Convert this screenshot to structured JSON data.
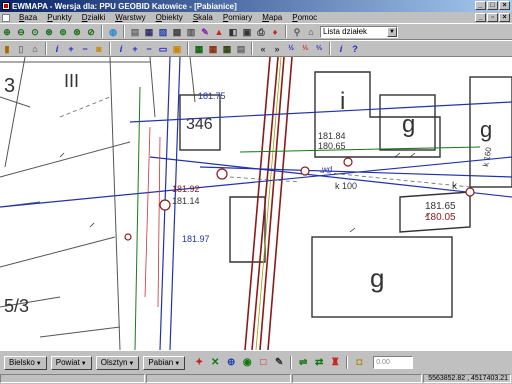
{
  "window": {
    "title": "EWMAPA - Wersja dla: PPU GEOBID Katowice - [Pabianice]"
  },
  "menu": {
    "items": [
      "Baza",
      "Punkty",
      "Działki",
      "Warstwy",
      "Obiekty",
      "Skala",
      "Pomiary",
      "Mapa",
      "Pomoc"
    ]
  },
  "toolbar": {
    "parcel_combo": "Lista działek"
  },
  "bottom": {
    "nav": [
      "Bielsko",
      "Powiat",
      "Olsztyn",
      "Pabian"
    ],
    "scale_value": "0.00"
  },
  "status": {
    "coordinates": "5563852.82 , 4517403.21"
  },
  "map": {
    "labels": {
      "lbl_3_left": "3",
      "lbl_iii": "III",
      "lbl_346": "346",
      "lbl_i": "i",
      "lbl_g1": "g",
      "lbl_g2": "g",
      "lbl_g3": "g",
      "lbl_53": "5/3",
      "lbl_18175": "181.75",
      "lbl_18184": "181.84",
      "lbl_18065": "180.65",
      "lbl_18192": "181.92",
      "lbl_18114": "181.14",
      "lbl_18165": "181.65",
      "lbl_18005": "180.05",
      "lbl_18197": "181.97",
      "lbl_k100": "k 100",
      "lbl_k": "k",
      "lbl_wd": "wd",
      "lbl_k160": "k 160"
    }
  },
  "colors": {
    "title_start": "#0a246a",
    "title_end": "#a6caf0",
    "road_red": "#8b1a1a",
    "utility_blue": "#2233aa",
    "utility_green": "#1a7a1a",
    "building_grey": "#555555"
  }
}
